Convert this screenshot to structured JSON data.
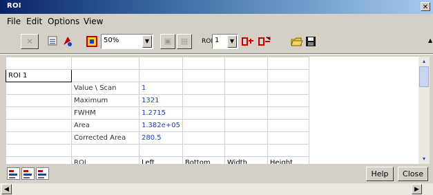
{
  "window": {
    "title": "ROI",
    "close_glyph": "✕"
  },
  "menu": [
    "File",
    "Edit",
    "Options",
    "View"
  ],
  "toolbar": {
    "zoom_value": "50%",
    "roi_label": "ROI",
    "roi_value": "1",
    "icons": [
      "delete-roi-icon",
      "properties-icon",
      "color-icon",
      "zoom-icon",
      "disabled-a-icon",
      "disabled-b-icon",
      "roi-add-icon",
      "roi-remove-icon",
      "open-folder-icon",
      "save-icon"
    ]
  },
  "table": {
    "rows": [
      [
        "",
        "",
        "",
        "",
        "",
        ""
      ],
      [
        "ROI 1",
        "",
        "",
        "",
        "",
        ""
      ],
      [
        "",
        "Value  \\  Scan",
        "1",
        "",
        "",
        ""
      ],
      [
        "",
        "Maximum",
        "1321",
        "",
        "",
        ""
      ],
      [
        "",
        "FWHM",
        "1.2715",
        "",
        "",
        ""
      ],
      [
        "",
        "Area",
        "1.382e+05",
        "",
        "",
        ""
      ],
      [
        "",
        "Corrected Area",
        "280.5",
        "",
        "",
        ""
      ],
      [
        "",
        "",
        "",
        "",
        "",
        ""
      ],
      [
        "",
        "ROI",
        "Left",
        "Bottom",
        "Width",
        "Height"
      ]
    ]
  },
  "buttons": {
    "help": "Help",
    "close": "Close"
  },
  "colors": {
    "titlebar_start": "#0a246a",
    "value_text": "#1a3cc8",
    "panel": "#d4d0c8"
  }
}
